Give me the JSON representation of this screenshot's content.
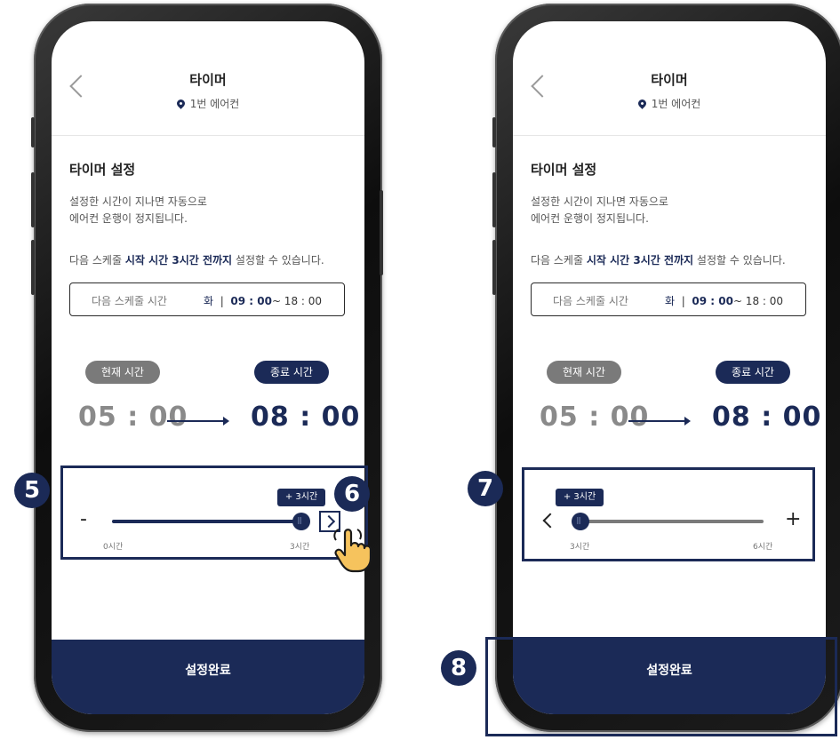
{
  "header": {
    "title": "타이머",
    "location": "1번 에어컨"
  },
  "section": {
    "title": "타이머 설정",
    "desc_line1": "설정한 시간이 지나면 자동으로",
    "desc_line2": "에어컨 운행이 정지됩니다.",
    "note_prefix": "다음 스케줄 ",
    "note_bold": "시작 시간 3시간 전까지",
    "note_suffix": " 설정할 수 있습니다."
  },
  "schedule": {
    "label": "다음 스케줄 시간",
    "day": "화",
    "sep": "|",
    "start": "09 : 00",
    "end": "~ 18 : 00"
  },
  "times": {
    "current_label": "현재 시간",
    "end_label": "종료 시간",
    "current": "05 : 00",
    "end": "08 : 00"
  },
  "slider_left": {
    "badge": "+ 3시간",
    "min_label": "0시간",
    "max_label": "3시간",
    "minus": "-"
  },
  "slider_right": {
    "badge": "+ 3시간",
    "min_label": "3시간",
    "max_label": "6시간",
    "plus": "+"
  },
  "confirm_label": "설정완료",
  "callouts": {
    "n5": "5",
    "n6": "6",
    "n7": "7",
    "n8": "8"
  },
  "colors": {
    "navy": "#1b2a57",
    "gray": "#7a7a7a"
  },
  "icons": {
    "back": "chevron-left-icon",
    "pin": "location-pin-icon",
    "next": "chevron-right-icon",
    "hand": "pointing-hand-icon"
  }
}
